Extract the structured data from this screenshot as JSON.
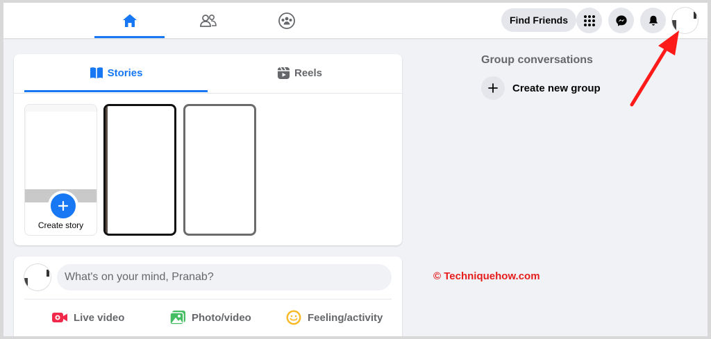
{
  "topbar": {
    "nav": [
      {
        "name": "home-icon",
        "active": true
      },
      {
        "name": "friends-icon",
        "active": false
      },
      {
        "name": "groups-icon",
        "active": false
      }
    ],
    "find_friends_label": "Find Friends",
    "icons": [
      "menu-grid-icon",
      "messenger-icon",
      "notifications-bell-icon",
      "profile-avatar"
    ]
  },
  "stories_card": {
    "tabs": [
      {
        "label": "Stories",
        "icon": "book-icon",
        "active": true
      },
      {
        "label": "Reels",
        "icon": "reels-icon",
        "active": false
      }
    ],
    "create_story_label": "Create story"
  },
  "composer": {
    "placeholder": "What's on your mind, Pranab?",
    "actions": [
      {
        "label": "Live video",
        "icon": "live-video-icon",
        "color": "#f02849"
      },
      {
        "label": "Photo/video",
        "icon": "photo-icon",
        "color": "#45bd62"
      },
      {
        "label": "Feeling/activity",
        "icon": "feeling-icon",
        "color": "#f7b928"
      }
    ]
  },
  "sidebar": {
    "title": "Group conversations",
    "create_group_label": "Create new group"
  },
  "watermark": "© Techniquehow.com",
  "colors": {
    "accent": "#1877f2",
    "annotation_arrow": "#ff1a1a"
  }
}
